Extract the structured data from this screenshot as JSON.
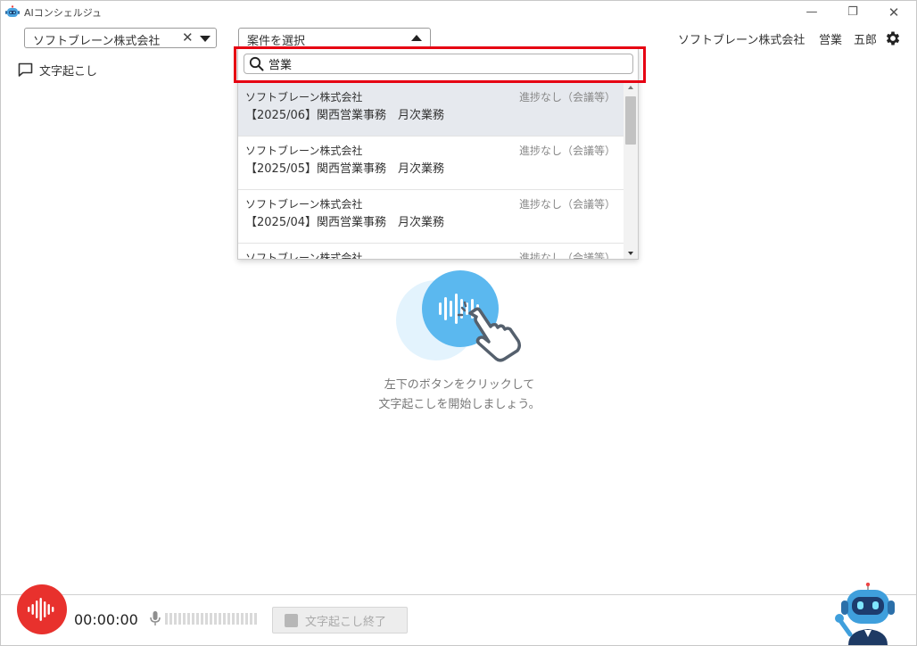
{
  "window": {
    "title": "AIコンシェルジュ",
    "controls": {
      "minimize": "—",
      "maximize": "❐",
      "close": "✕"
    }
  },
  "toolbar": {
    "company_select": {
      "value": "ソフトブレーン株式会社",
      "clear_icon": "close-icon",
      "caret_icon": "chevron-down-icon"
    },
    "case_select": {
      "placeholder": "案件を選択",
      "caret_icon": "chevron-up-icon"
    },
    "user": {
      "company": "ソフトブレーン株式会社",
      "department": "営業",
      "name": "五郎"
    },
    "settings_icon": "gear-icon"
  },
  "tabs": {
    "transcribe": {
      "label": "文字起こし",
      "icon": "chat-bubble-icon"
    }
  },
  "dropdown": {
    "search": {
      "value": "営業",
      "icon": "search-icon"
    },
    "items": [
      {
        "company": "ソフトブレーン株式会社",
        "status": "進捗なし（会議等）",
        "name": "【2025/06】関西営業事務　月次業務",
        "selected": true
      },
      {
        "company": "ソフトブレーン株式会社",
        "status": "進捗なし（会議等）",
        "name": "【2025/05】関西営業事務　月次業務",
        "selected": false
      },
      {
        "company": "ソフトブレーン株式会社",
        "status": "進捗なし（会議等）",
        "name": "【2025/04】関西営業事務　月次業務",
        "selected": false
      },
      {
        "company": "ソフトブレーン株式会社",
        "status": "進捗なし（会議等）",
        "name": "",
        "selected": false
      }
    ]
  },
  "center": {
    "hint_line1": "左下のボタンをクリックして",
    "hint_line2": "文字起こしを開始しましょう。"
  },
  "bottom": {
    "timer": "00:00:00",
    "stop_label": "文字起こし終了",
    "record_icon": "sound-wave-icon",
    "mic_icon": "microphone-icon"
  },
  "colors": {
    "accent_red": "#e8312d",
    "highlight_red": "#e60012",
    "illustration_blue": "#5bb8ef",
    "selected_row": "#e6e9ee"
  }
}
